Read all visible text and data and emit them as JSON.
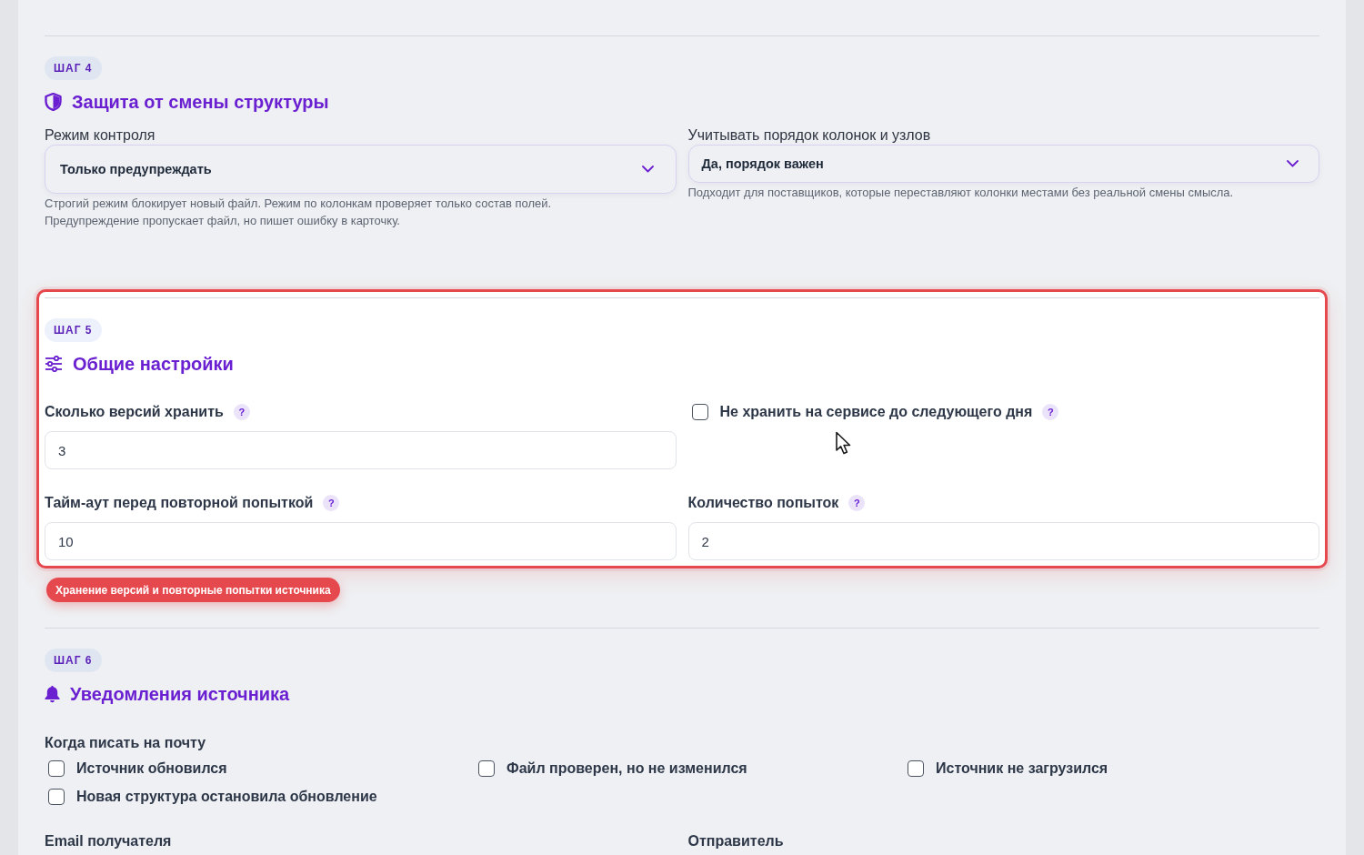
{
  "sections": [
    {
      "badge": "ШАГ 4",
      "title": "Защита от смены структуры",
      "highlighted": false,
      "fields": [
        {
          "kind": "select",
          "label": "Режим контроля",
          "value": "Только предупреждать",
          "hint": "Строгий режим блокирует новый файл. Режим по колонкам проверяет только состав полей. Предупреждение пропускает файл, но пишет ошибку в карточку."
        },
        {
          "kind": "select",
          "label": "Учитывать порядок колонок и узлов",
          "value": "Да, порядок важен",
          "hint": "Подходит для поставщиков, которые переставляют колонки местами без реальной смены смысла."
        }
      ]
    },
    {
      "badge": "ШАГ 5",
      "title": "Общие настройки",
      "highlighted": true,
      "tag": "Хранение версий и повторные попытки источника",
      "fields": [
        {
          "kind": "input",
          "label": "Сколько версий хранить",
          "help": "?",
          "value": "3"
        },
        {
          "kind": "checkbox",
          "label": "Не хранить на сервисе до следующего дня",
          "help": "?",
          "checked": false
        },
        {
          "kind": "input",
          "label": "Тайм-аут перед повторной попыткой",
          "help": "?",
          "value": "10"
        },
        {
          "kind": "input",
          "label": "Количество попыток",
          "help": "?",
          "value": "2"
        }
      ]
    },
    {
      "badge": "ШАГ 6",
      "title": "Уведомления источника",
      "highlighted": false,
      "fields": [
        {
          "kind": "checkbox_group",
          "label": "Когда писать на почту",
          "options": [
            {
              "label": "Источник обновился",
              "checked": false
            },
            {
              "label": "Файл проверен, но не изменился",
              "checked": false
            },
            {
              "label": "Источник не загрузился",
              "checked": false
            },
            {
              "label": "Новая структура остановила обновление",
              "checked": false
            }
          ]
        },
        {
          "kind": "label",
          "label": "Email получателя"
        },
        {
          "kind": "label",
          "label": "Отправитель"
        }
      ]
    }
  ]
}
